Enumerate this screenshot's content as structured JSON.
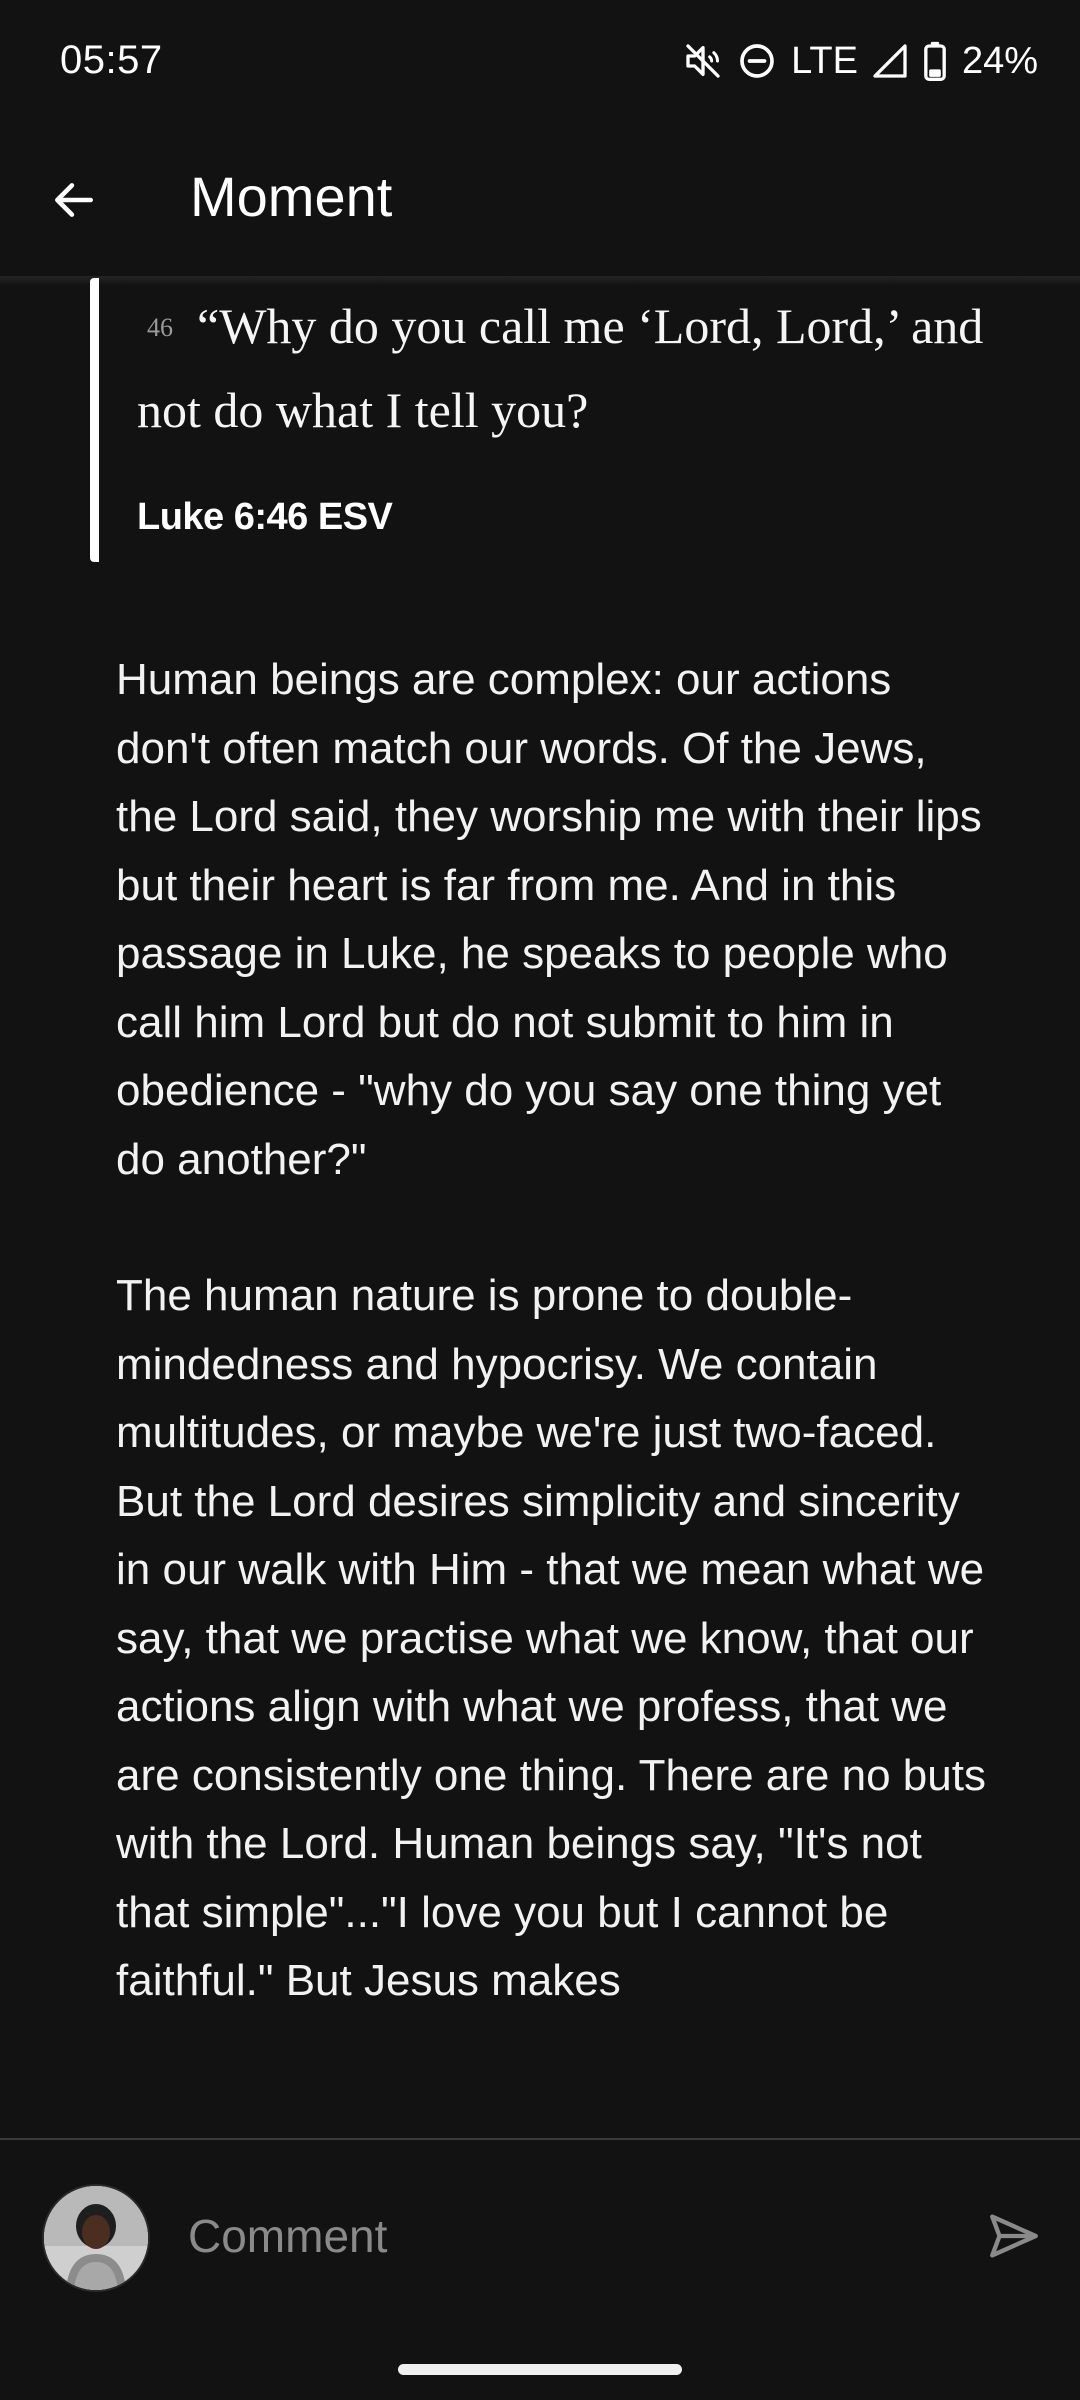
{
  "status_bar": {
    "time": "05:57",
    "network": "LTE",
    "battery": "24%",
    "icons": [
      "mute-icon",
      "do-not-disturb-icon",
      "signal-icon",
      "battery-icon"
    ]
  },
  "app_bar": {
    "title": "Moment",
    "back_icon": "arrow-left-icon"
  },
  "verse": {
    "number": "46",
    "text": "“Why do you call me ‘Lord, Lord,’ and not do what I tell you?",
    "reference": "Luke 6:46 ESV"
  },
  "body": {
    "paragraphs": [
      "Human beings are complex: our actions don't often match our words. Of the Jews, the Lord said, they worship me with their lips but their heart is far from me. And in this passage in Luke, he speaks to people who call him Lord but do not submit to him in obedience - \"why do you say one thing yet do another?\"",
      "The human nature is prone to double-mindedness and hypocrisy. We contain multitudes, or maybe we're just two-faced. But the Lord desires simplicity and sincerity in our walk with Him - that we mean what we say, that we practise what we know, that our actions align with what we profess, that we are consistently one thing. There are no buts with the Lord. Human beings say, \"It's not that simple\"...\"I love you but I cannot be faithful.\" But Jesus makes"
    ]
  },
  "comment_bar": {
    "placeholder": "Comment",
    "send_icon": "send-icon"
  },
  "colors": {
    "background": "#121212",
    "text": "#f2f2f2",
    "quote_bar": "#ffffff",
    "placeholder": "#8a8a8a"
  }
}
